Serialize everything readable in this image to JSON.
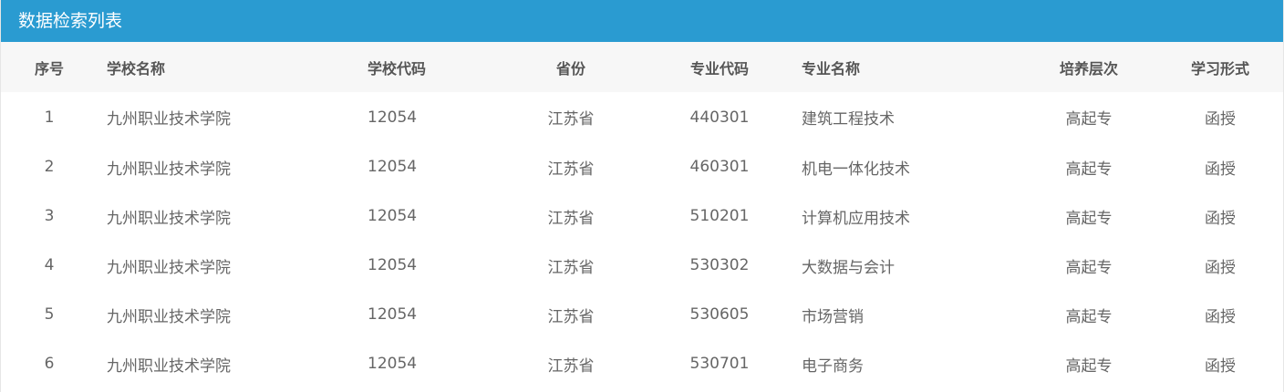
{
  "panel": {
    "title": "数据检索列表"
  },
  "table": {
    "columns": [
      "序号",
      "学校名称",
      "学校代码",
      "省份",
      "专业代码",
      "专业名称",
      "培养层次",
      "学习形式"
    ],
    "rows": [
      [
        "1",
        "九州职业技术学院",
        "12054",
        "江苏省",
        "440301",
        "建筑工程技术",
        "高起专",
        "函授"
      ],
      [
        "2",
        "九州职业技术学院",
        "12054",
        "江苏省",
        "460301",
        "机电一体化技术",
        "高起专",
        "函授"
      ],
      [
        "3",
        "九州职业技术学院",
        "12054",
        "江苏省",
        "510201",
        "计算机应用技术",
        "高起专",
        "函授"
      ],
      [
        "4",
        "九州职业技术学院",
        "12054",
        "江苏省",
        "530302",
        "大数据与会计",
        "高起专",
        "函授"
      ],
      [
        "5",
        "九州职业技术学院",
        "12054",
        "江苏省",
        "530605",
        "市场营销",
        "高起专",
        "函授"
      ],
      [
        "6",
        "九州职业技术学院",
        "12054",
        "江苏省",
        "530701",
        "电子商务",
        "高起专",
        "函授"
      ]
    ]
  },
  "colors": {
    "title_bar": "#2a9bd1",
    "header_bg": "#f7f7f7"
  }
}
